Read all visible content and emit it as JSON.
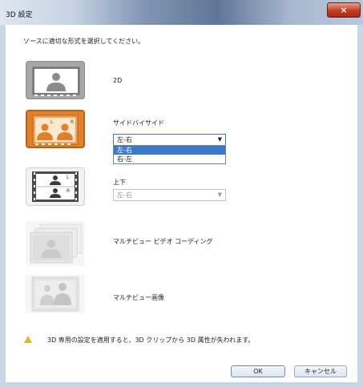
{
  "window": {
    "title": "3D 設定",
    "close_glyph": "×"
  },
  "instruction": "ソースに適切な形式を選択してください。",
  "options": [
    {
      "label": "2D"
    },
    {
      "label": "サイドバイサイド",
      "dropdown_value": "左-右",
      "dropdown_options": [
        "左-右",
        "右-左"
      ],
      "selected": true
    },
    {
      "label": "上下",
      "dropdown_value": "左-右"
    },
    {
      "label": "マルチビュー ビデオ コーディング"
    },
    {
      "label": "マルチビュー画像"
    }
  ],
  "warning": "3D 専用の設定を適用すると、3D クリップから 3D 属性が失われます。",
  "buttons": {
    "ok": "OK",
    "cancel": "キャンセル"
  },
  "colors": {
    "accent": "#e0802a",
    "selection": "#3d77c9"
  },
  "icons": [
    "person-icon",
    "side-by-side-icon",
    "top-bottom-icon",
    "multiview-video-icon",
    "multiview-image-icon",
    "warning-icon",
    "close-icon"
  ]
}
